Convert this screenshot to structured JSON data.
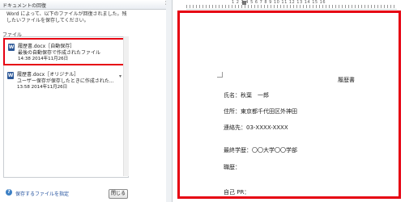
{
  "recovery_pane": {
    "title": "ドキュメントの回復",
    "close": "×",
    "description": "Word によって、以下のファイルが回復されました。残したいファイルを保存してください。",
    "files_label": "ファイル",
    "files": [
      {
        "name": "履歴書.docx［自動保存］",
        "desc": "最後の自動保存で作成されたファイル",
        "time": "14:38 2014年11月26日"
      },
      {
        "name": "履歴書.docx［オリジナル］",
        "desc": "ユーザー保存が保存したときに作成された...",
        "time": "13:58 2014年11月26日"
      }
    ],
    "help_link": "保存するファイルを指定",
    "close_button": "閉じる",
    "accent_color": "#e60012"
  },
  "ruler": {
    "numbers": "1 2 3 4 5 6 7 8 9 10 11 12 13 14 15 16"
  },
  "document": {
    "title": "履歴書",
    "lines": [
      "氏名：秋葉　一郎",
      "住所：東京都千代田区外神田",
      "連絡先：03-XXXX-XXXX",
      "最終学歴：〇〇大学〇〇学部",
      "職歴：",
      "自己 PR："
    ]
  }
}
